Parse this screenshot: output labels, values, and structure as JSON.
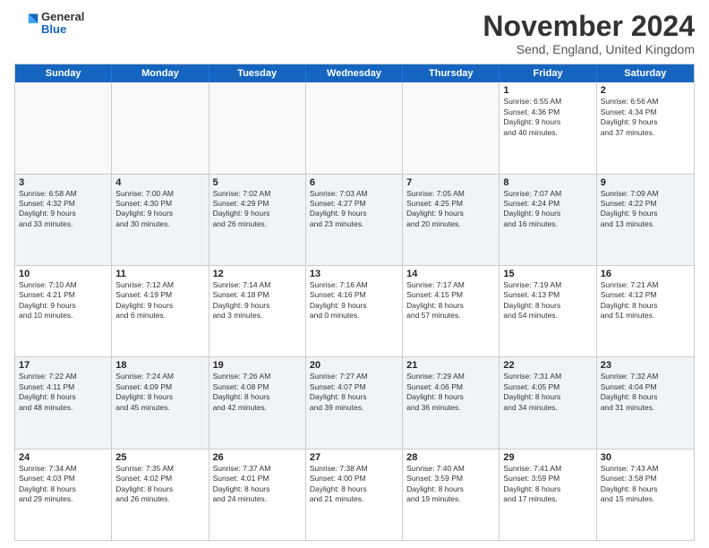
{
  "logo": {
    "general": "General",
    "blue": "Blue"
  },
  "title": "November 2024",
  "subtitle": "Send, England, United Kingdom",
  "weekdays": [
    "Sunday",
    "Monday",
    "Tuesday",
    "Wednesday",
    "Thursday",
    "Friday",
    "Saturday"
  ],
  "rows": [
    [
      {
        "day": "",
        "info": ""
      },
      {
        "day": "",
        "info": ""
      },
      {
        "day": "",
        "info": ""
      },
      {
        "day": "",
        "info": ""
      },
      {
        "day": "",
        "info": ""
      },
      {
        "day": "1",
        "info": "Sunrise: 6:55 AM\nSunset: 4:36 PM\nDaylight: 9 hours\nand 40 minutes."
      },
      {
        "day": "2",
        "info": "Sunrise: 6:56 AM\nSunset: 4:34 PM\nDaylight: 9 hours\nand 37 minutes."
      }
    ],
    [
      {
        "day": "3",
        "info": "Sunrise: 6:58 AM\nSunset: 4:32 PM\nDaylight: 9 hours\nand 33 minutes."
      },
      {
        "day": "4",
        "info": "Sunrise: 7:00 AM\nSunset: 4:30 PM\nDaylight: 9 hours\nand 30 minutes."
      },
      {
        "day": "5",
        "info": "Sunrise: 7:02 AM\nSunset: 4:29 PM\nDaylight: 9 hours\nand 26 minutes."
      },
      {
        "day": "6",
        "info": "Sunrise: 7:03 AM\nSunset: 4:27 PM\nDaylight: 9 hours\nand 23 minutes."
      },
      {
        "day": "7",
        "info": "Sunrise: 7:05 AM\nSunset: 4:25 PM\nDaylight: 9 hours\nand 20 minutes."
      },
      {
        "day": "8",
        "info": "Sunrise: 7:07 AM\nSunset: 4:24 PM\nDaylight: 9 hours\nand 16 minutes."
      },
      {
        "day": "9",
        "info": "Sunrise: 7:09 AM\nSunset: 4:22 PM\nDaylight: 9 hours\nand 13 minutes."
      }
    ],
    [
      {
        "day": "10",
        "info": "Sunrise: 7:10 AM\nSunset: 4:21 PM\nDaylight: 9 hours\nand 10 minutes."
      },
      {
        "day": "11",
        "info": "Sunrise: 7:12 AM\nSunset: 4:19 PM\nDaylight: 9 hours\nand 6 minutes."
      },
      {
        "day": "12",
        "info": "Sunrise: 7:14 AM\nSunset: 4:18 PM\nDaylight: 9 hours\nand 3 minutes."
      },
      {
        "day": "13",
        "info": "Sunrise: 7:16 AM\nSunset: 4:16 PM\nDaylight: 9 hours\nand 0 minutes."
      },
      {
        "day": "14",
        "info": "Sunrise: 7:17 AM\nSunset: 4:15 PM\nDaylight: 8 hours\nand 57 minutes."
      },
      {
        "day": "15",
        "info": "Sunrise: 7:19 AM\nSunset: 4:13 PM\nDaylight: 8 hours\nand 54 minutes."
      },
      {
        "day": "16",
        "info": "Sunrise: 7:21 AM\nSunset: 4:12 PM\nDaylight: 8 hours\nand 51 minutes."
      }
    ],
    [
      {
        "day": "17",
        "info": "Sunrise: 7:22 AM\nSunset: 4:11 PM\nDaylight: 8 hours\nand 48 minutes."
      },
      {
        "day": "18",
        "info": "Sunrise: 7:24 AM\nSunset: 4:09 PM\nDaylight: 8 hours\nand 45 minutes."
      },
      {
        "day": "19",
        "info": "Sunrise: 7:26 AM\nSunset: 4:08 PM\nDaylight: 8 hours\nand 42 minutes."
      },
      {
        "day": "20",
        "info": "Sunrise: 7:27 AM\nSunset: 4:07 PM\nDaylight: 8 hours\nand 39 minutes."
      },
      {
        "day": "21",
        "info": "Sunrise: 7:29 AM\nSunset: 4:06 PM\nDaylight: 8 hours\nand 36 minutes."
      },
      {
        "day": "22",
        "info": "Sunrise: 7:31 AM\nSunset: 4:05 PM\nDaylight: 8 hours\nand 34 minutes."
      },
      {
        "day": "23",
        "info": "Sunrise: 7:32 AM\nSunset: 4:04 PM\nDaylight: 8 hours\nand 31 minutes."
      }
    ],
    [
      {
        "day": "24",
        "info": "Sunrise: 7:34 AM\nSunset: 4:03 PM\nDaylight: 8 hours\nand 29 minutes."
      },
      {
        "day": "25",
        "info": "Sunrise: 7:35 AM\nSunset: 4:02 PM\nDaylight: 8 hours\nand 26 minutes."
      },
      {
        "day": "26",
        "info": "Sunrise: 7:37 AM\nSunset: 4:01 PM\nDaylight: 8 hours\nand 24 minutes."
      },
      {
        "day": "27",
        "info": "Sunrise: 7:38 AM\nSunset: 4:00 PM\nDaylight: 8 hours\nand 21 minutes."
      },
      {
        "day": "28",
        "info": "Sunrise: 7:40 AM\nSunset: 3:59 PM\nDaylight: 8 hours\nand 19 minutes."
      },
      {
        "day": "29",
        "info": "Sunrise: 7:41 AM\nSunset: 3:59 PM\nDaylight: 8 hours\nand 17 minutes."
      },
      {
        "day": "30",
        "info": "Sunrise: 7:43 AM\nSunset: 3:58 PM\nDaylight: 8 hours\nand 15 minutes."
      }
    ]
  ]
}
